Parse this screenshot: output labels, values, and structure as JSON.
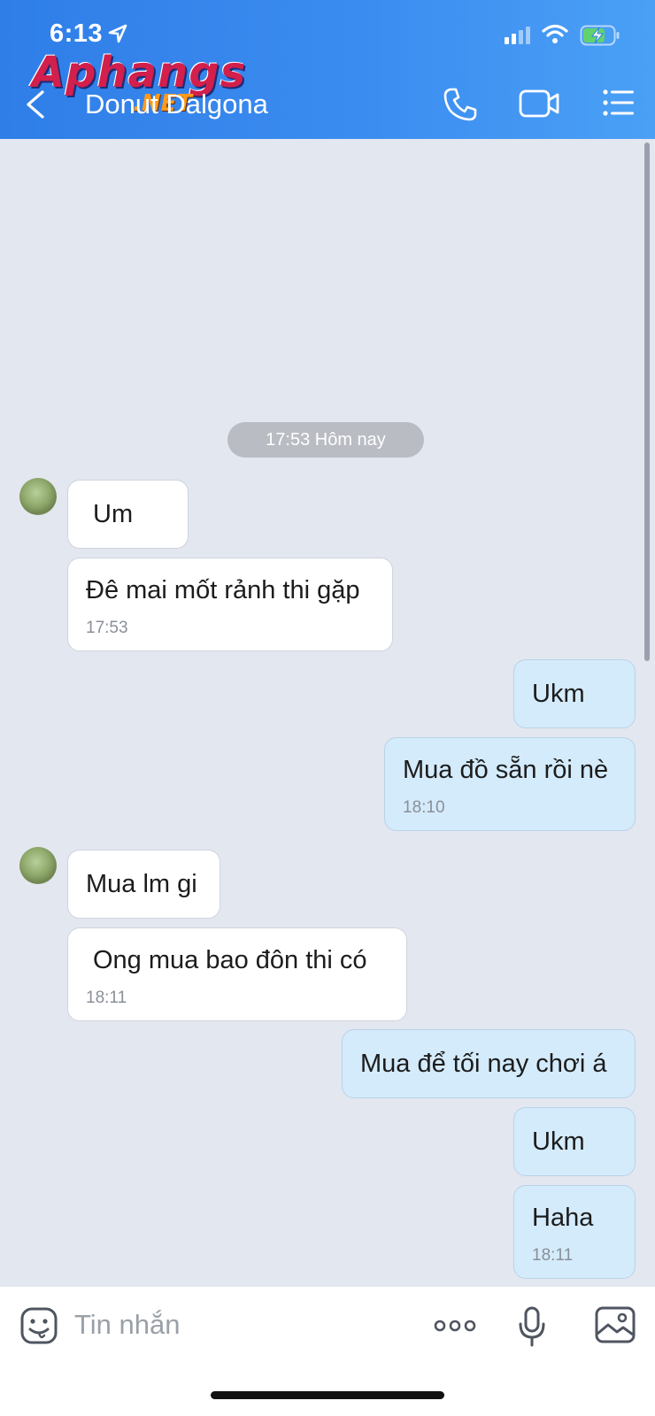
{
  "status_bar": {
    "time": "6:13"
  },
  "watermark": {
    "main": "Aphangs",
    "suffix": ".NET"
  },
  "header": {
    "contact_name": "Donut Dalgona"
  },
  "chat": {
    "date_separator": "17:53 Hôm nay",
    "messages": [
      {
        "side": "in",
        "text": "Um",
        "time": ""
      },
      {
        "side": "in",
        "text": "Đê mai mốt rảnh thi gặp",
        "time": "17:53"
      },
      {
        "side": "out",
        "text": "Ukm",
        "time": ""
      },
      {
        "side": "out",
        "text": "Mua đồ sẵn rồi nè",
        "time": "18:10"
      },
      {
        "side": "in",
        "text": "Mua lm gi",
        "time": ""
      },
      {
        "side": "in",
        "text": "Ong mua bao đôn thi có",
        "time": "18:11"
      },
      {
        "side": "out",
        "text": "Mua để tối nay chơi á",
        "time": ""
      },
      {
        "side": "out",
        "text": "Ukm",
        "time": ""
      },
      {
        "side": "out",
        "text": "Haha",
        "time": "18:11"
      }
    ]
  },
  "input": {
    "placeholder": "Tin nhắn"
  },
  "colors": {
    "header": "#3b8cf0",
    "chat_bg": "#e3e7ef",
    "out_bubble": "#d4ebfb",
    "in_bubble": "#ffffff"
  },
  "icons": [
    "location-arrow-icon",
    "signal-icon",
    "wifi-icon",
    "battery-charging-icon",
    "back-chevron-icon",
    "phone-icon",
    "video-camera-icon",
    "list-menu-icon",
    "emoji-icon",
    "more-dots-icon",
    "microphone-icon",
    "image-icon"
  ]
}
